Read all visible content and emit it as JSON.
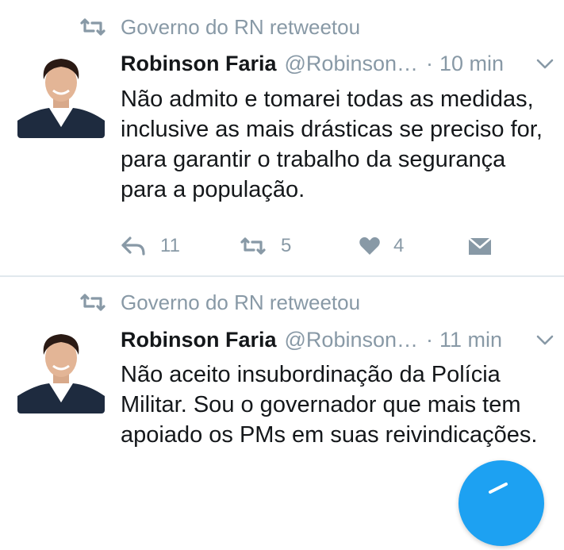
{
  "tweets": [
    {
      "retweet_label": "Governo do RN retweetou",
      "author_name": "Robinson Faria",
      "handle": "@Robinson…",
      "separator": "·",
      "time": "10 min",
      "text": "Não admito e tomarei todas as medidas, inclusive as mais drásticas se preciso for, para garantir o trabalho da segurança para a população.",
      "replies": "11",
      "retweets": "5",
      "likes": "4"
    },
    {
      "retweet_label": "Governo do RN retweetou",
      "author_name": "Robinson Faria",
      "handle": "@Robinson…",
      "separator": "·",
      "time": "11 min",
      "text": "Não aceito insubordinação da Polícia Militar. Sou o governador que mais tem apoiado os PMs em suas reivindicações."
    }
  ],
  "colors": {
    "accent": "#1da1f2",
    "muted": "#8899a6",
    "text": "#14171a",
    "divider": "#e1e8ed"
  },
  "icons": [
    "retweet-icon",
    "chevron-down-icon",
    "reply-icon",
    "heart-icon",
    "direct-message-icon",
    "compose-icon"
  ]
}
